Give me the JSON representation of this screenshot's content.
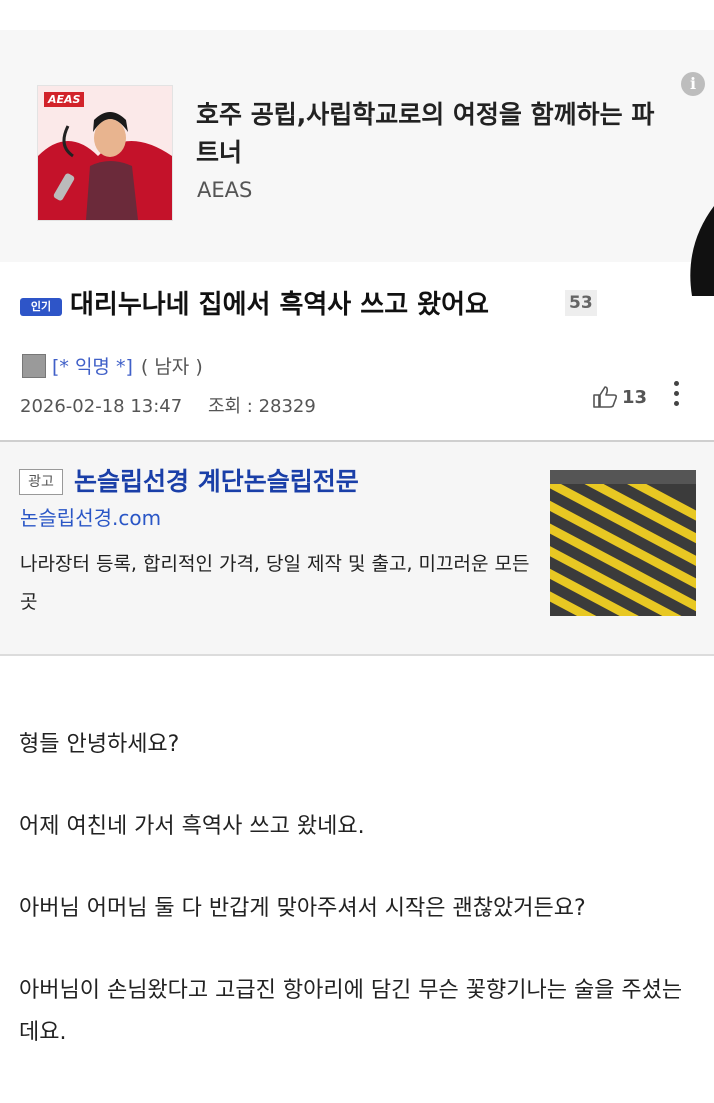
{
  "top_ad": {
    "logo_text": "AEAS",
    "title": "호주 공립,사립학교로의 여정을 함께하는 파트너",
    "brand": "AEAS",
    "info_icon": "info-icon"
  },
  "post": {
    "hot_badge": "인기",
    "title": "대리누나네 집에서 흑역사 쓰고 왔어요",
    "comment_count": "53",
    "author": "[* 익명 *]",
    "gender": "( 남자 )",
    "date": "2026-02-18 13:47",
    "views": "조회 : 28329",
    "likes": "13"
  },
  "mid_ad": {
    "label": "광고",
    "headline": "논슬립선경 계단논슬립전문",
    "url": "논슬립선경.com",
    "description": "나라장터 등록, 합리적인 가격, 당일 제작 및 출고, 미끄러운 모든곳"
  },
  "body": {
    "p1": "형들 안녕하세요?",
    "p2": "어제 여친네 가서 흑역사 쓰고 왔네요.",
    "p3": "아버님 어머님 둘 다 반갑게 맞아주셔서 시작은 괜찮았거든요?",
    "p4": "아버님이 손님왔다고 고급진 항아리에 담긴 무슨 꽃향기나는 술을 주셨는데요."
  },
  "colors": {
    "accent_blue": "#2e55c8",
    "ad_headline": "#1a3fa8",
    "ad_bg": "#f6f6f6"
  }
}
